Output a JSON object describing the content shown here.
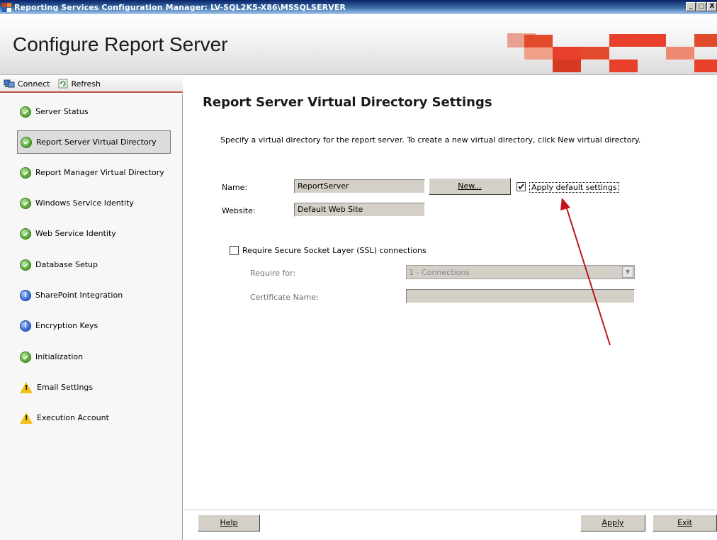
{
  "window": {
    "title": "Reporting Services Configuration Manager: LV-SQL2K5-X86\\MSSQLSERVER",
    "controls": [
      "_",
      "□",
      "X"
    ]
  },
  "header": {
    "title": "Configure Report Server",
    "tile_color": "#e8402a"
  },
  "toolbar": {
    "connect_label": "Connect",
    "refresh_label": "Refresh"
  },
  "sidebar": {
    "items": [
      {
        "label": "Server Status",
        "status": "ok",
        "icon": "green-check-icon"
      },
      {
        "label": "Report Server Virtual Directory",
        "status": "ok",
        "icon": "green-check-icon",
        "selected": true
      },
      {
        "label": "Report Manager Virtual Directory",
        "status": "ok",
        "icon": "green-check-icon"
      },
      {
        "label": "Windows Service Identity",
        "status": "ok",
        "icon": "green-check-icon"
      },
      {
        "label": "Web Service Identity",
        "status": "ok",
        "icon": "green-check-icon"
      },
      {
        "label": "Database Setup",
        "status": "ok",
        "icon": "green-check-icon"
      },
      {
        "label": "SharePoint Integration",
        "status": "info",
        "icon": "info-icon"
      },
      {
        "label": "Encryption Keys",
        "status": "info",
        "icon": "info-icon"
      },
      {
        "label": "Initialization",
        "status": "ok",
        "icon": "green-check-icon"
      },
      {
        "label": "Email Settings",
        "status": "warning",
        "icon": "warning-icon"
      },
      {
        "label": "Execution Account",
        "status": "warning",
        "icon": "warning-icon"
      }
    ]
  },
  "main": {
    "title": "Report Server Virtual Directory Settings",
    "description": "Specify a virtual directory for the report server. To create a new virtual directory, click New virtual directory.",
    "name_label": "Name:",
    "name_value": "ReportServer",
    "new_button": "New...",
    "apply_default_label": "Apply default settings",
    "apply_default_checked": true,
    "website_label": "Website:",
    "website_value": "Default Web Site",
    "ssl_label": "Require Secure Socket Layer (SSL) connections",
    "ssl_checked": false,
    "require_for_label": "Require for:",
    "require_for_value": "1 - Connections",
    "certificate_label": "Certificate Name:",
    "certificate_value": ""
  },
  "footer": {
    "help_label": "Help",
    "apply_label": "Apply",
    "exit_label": "Exit"
  },
  "colors": {
    "annotation_arrow": "#c0141c",
    "sidebar_accent": "#c0504d"
  }
}
